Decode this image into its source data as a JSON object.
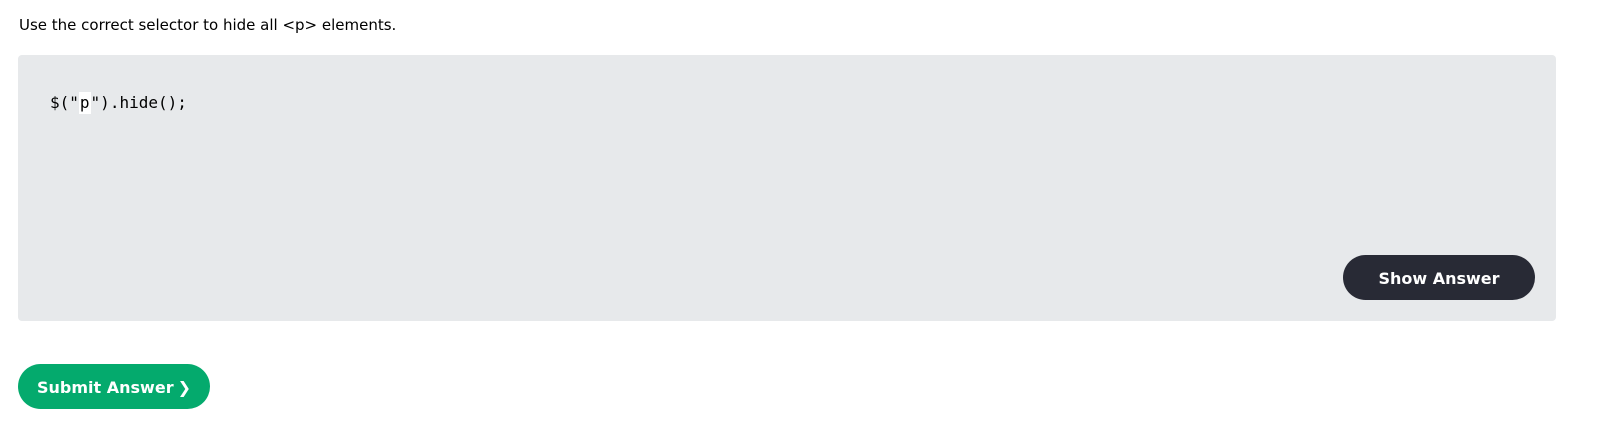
{
  "exercise": {
    "instruction": "Use the correct selector to hide all <p> elements.",
    "code": {
      "prefix": "$(\"",
      "input_value": "p",
      "suffix": "\").hide();"
    },
    "show_answer_label": "Show Answer"
  },
  "submit": {
    "label": "Submit Answer",
    "icon": "chevron-right-icon",
    "glyph": "❯"
  },
  "colors": {
    "box_background": "#e7e9eb",
    "show_answer_bg": "#282a35",
    "submit_bg": "#04aa6d"
  }
}
